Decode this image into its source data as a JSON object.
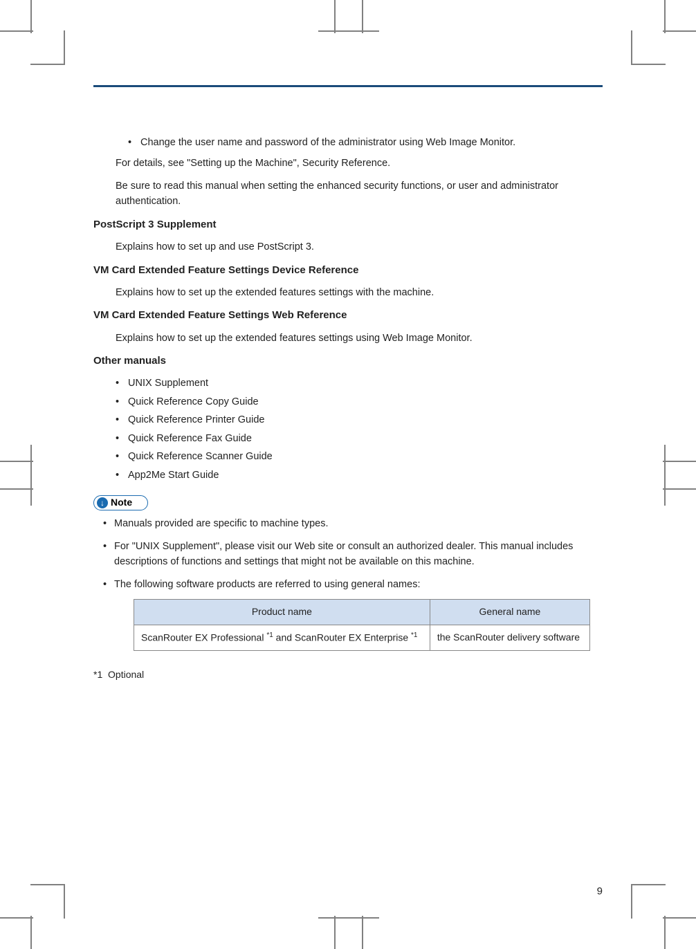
{
  "body": {
    "bullet1": "Change the user name and password of the administrator using Web Image Monitor.",
    "p1": "For details, see \"Setting up the Machine\", Security Reference.",
    "p2": "Be sure to read this manual when setting the enhanced security functions, or user and administrator authentication.",
    "h1": "PostScript 3 Supplement",
    "p3": "Explains how to set up and use PostScript 3.",
    "h2": "VM Card Extended Feature Settings Device Reference",
    "p4": "Explains how to set up the extended features settings with the machine.",
    "h3": "VM Card Extended Feature Settings Web Reference",
    "p5": "Explains how to set up the extended features settings using Web Image Monitor.",
    "h4": "Other manuals",
    "other_list": [
      "UNIX Supplement",
      "Quick Reference Copy Guide",
      "Quick Reference Printer Guide",
      "Quick Reference Fax Guide",
      "Quick Reference Scanner Guide",
      "App2Me Start Guide"
    ],
    "note_label": "Note",
    "note_list": [
      "Manuals provided are specific to machine types.",
      "For \"UNIX Supplement\", please visit our Web site or consult an authorized dealer. This manual includes descriptions of functions and settings that might not be available on this machine.",
      "The following software products are referred to using general names:"
    ],
    "table": {
      "head": [
        "Product name",
        "General name"
      ],
      "row1": {
        "product_prefix": "ScanRouter EX Professional ",
        "product_sup1": "*1",
        "product_mid": " and ScanRouter EX Enterprise ",
        "product_sup2": "*1",
        "general": "the ScanRouter delivery software"
      }
    },
    "footnote_ref": "*1",
    "footnote_text": "Optional",
    "page_number": "9"
  }
}
